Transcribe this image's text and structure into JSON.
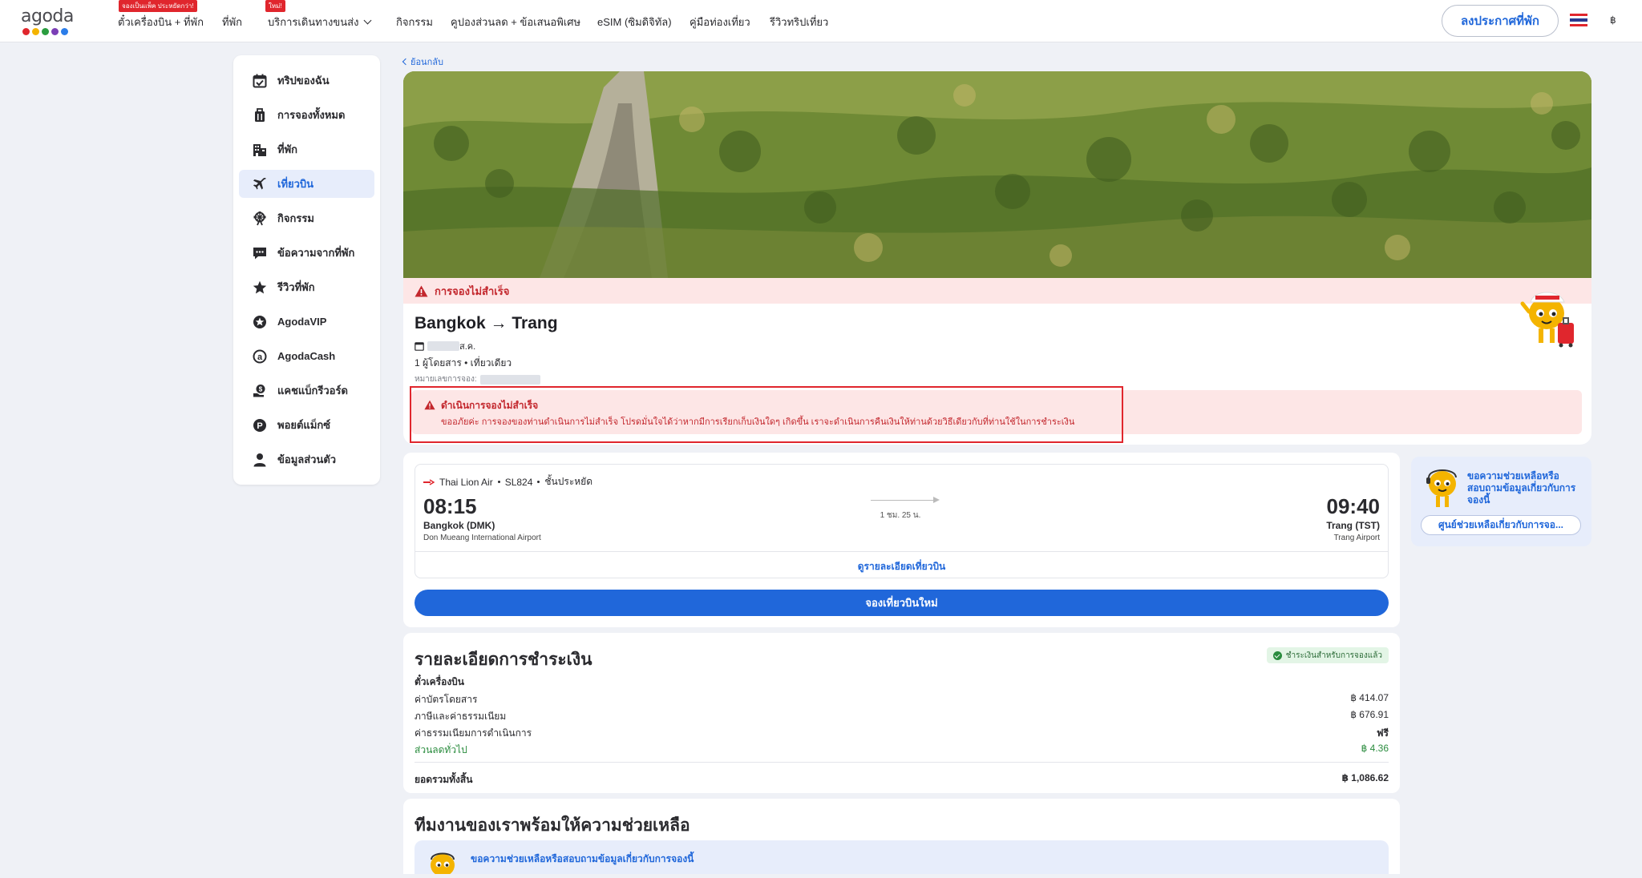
{
  "header": {
    "logo_text": "agoda",
    "logo_colors": [
      "#e0262d",
      "#f4b400",
      "#2a9d3f",
      "#7b3fb6",
      "#2b7de9"
    ],
    "nav": [
      {
        "label": "ตั๋วเครื่องบิน + ที่พัก",
        "badge": "จองเป็นแพ็ค ประหยัดกว่า!"
      },
      {
        "label": "ที่พัก",
        "badge": ""
      },
      {
        "label": "บริการเดินทางขนส่ง",
        "badge": "ใหม่!"
      },
      {
        "label": "กิจกรรม",
        "badge": ""
      },
      {
        "label": "คูปองส่วนลด + ข้อเสนอพิเศษ",
        "badge": ""
      },
      {
        "label": "eSIM (ซิมดิจิทัล)",
        "badge": ""
      },
      {
        "label": "คู่มือท่องเที่ยว",
        "badge": ""
      },
      {
        "label": "รีวิวทริปเที่ยว",
        "badge": ""
      }
    ],
    "list_property_label": "ลงประกาศที่พัก",
    "currency": "฿"
  },
  "sidebar": {
    "items": [
      {
        "label": "ทริปของฉัน",
        "icon": "calendar-check-icon",
        "active": false
      },
      {
        "label": "การจองทั้งหมด",
        "icon": "suitcase-icon",
        "active": false
      },
      {
        "label": "ที่พัก",
        "icon": "building-icon",
        "active": false
      },
      {
        "label": "เที่ยวบิน",
        "icon": "airplane-icon",
        "active": true
      },
      {
        "label": "กิจกรรม",
        "icon": "ferris-wheel-icon",
        "active": false
      },
      {
        "label": "ข้อความจากที่พัก",
        "icon": "chat-icon",
        "active": false
      },
      {
        "label": "รีวิวที่พัก",
        "icon": "star-icon",
        "active": false
      },
      {
        "label": "AgodaVIP",
        "icon": "vip-star-icon",
        "active": false
      },
      {
        "label": "AgodaCash",
        "icon": "agodacash-icon",
        "active": false
      },
      {
        "label": "แคชแบ็กรีวอร์ด",
        "icon": "cashback-icon",
        "active": false
      },
      {
        "label": "พอยต์แม็กซ์",
        "icon": "points-icon",
        "active": false
      },
      {
        "label": "ข้อมูลส่วนตัว",
        "icon": "person-icon",
        "active": false
      }
    ]
  },
  "back_label": "ย้อนกลับ",
  "booking": {
    "status_label": "การจองไม่สำเร็จ",
    "route": "Bangkok → Trang",
    "date_suffix": "ส.ค.",
    "passengers": "1 ผู้โดยสาร • เที่ยวเดียว",
    "booking_ref_label": "หมายเลขการจอง:",
    "error_title": "ดำเนินการจองไม่สำเร็จ",
    "error_message": "ขออภัยค่ะ การจองของท่านดำเนินการไม่สำเร็จ โปรดมั่นใจได้ว่าหากมีการเรียกเก็บเงินใดๆ เกิดขึ้น เราจะดำเนินการคืนเงินให้ท่านด้วยวิธีเดียวกับที่ท่านใช้ในการชำระเงิน"
  },
  "flight": {
    "airline": "Thai Lion Air",
    "flight_no": "SL824",
    "cabin": "ชั้นประหยัด",
    "dep_time": "08:15",
    "arr_time": "09:40",
    "duration": "1 ชม. 25 น.",
    "dep_city": "Bangkok (DMK)",
    "dep_airport": "Don Mueang International Airport",
    "arr_city": "Trang (TST)",
    "arr_airport": "Trang Airport",
    "view_details": "ดูรายละเอียดเที่ยวบิน",
    "rebook": "จองเที่ยวบินใหม่"
  },
  "help": {
    "text": "ขอความช่วยเหลือหรือสอบถามข้อมูลเกี่ยวกับการจองนี้",
    "button": "ศูนย์ช่วยเหลือเกี่ยวกับการจอ..."
  },
  "payment": {
    "title": "รายละเอียดการชำระเงิน",
    "paid_badge": "ชำระเงินสำหรับการจองแล้ว",
    "section": "ตั๋วเครื่องบิน",
    "rows": [
      {
        "label": "ค่าบัตรโดยสาร",
        "value": "฿ 414.07"
      },
      {
        "label": "ภาษีและค่าธรรมเนียม",
        "value": "฿ 676.91"
      },
      {
        "label": "ค่าธรรมเนียมการดำเนินการ",
        "value": "ฟรี"
      },
      {
        "label": "ส่วนลดทั่วไป",
        "value": "฿ 4.36"
      }
    ],
    "total_label": "ยอดรวมทั้งสิ้น",
    "total_value": "฿ 1,086.62"
  },
  "team": {
    "title": "ทีมงานของเราพร้อมให้ความช่วยเหลือ",
    "help_text": "ขอความช่วยเหลือหรือสอบถามข้อมูลเกี่ยวกับการจองนี้"
  },
  "colors": {
    "brand_blue": "#2067da",
    "error_red": "#c3272d",
    "success_green": "#2a8c3e"
  }
}
